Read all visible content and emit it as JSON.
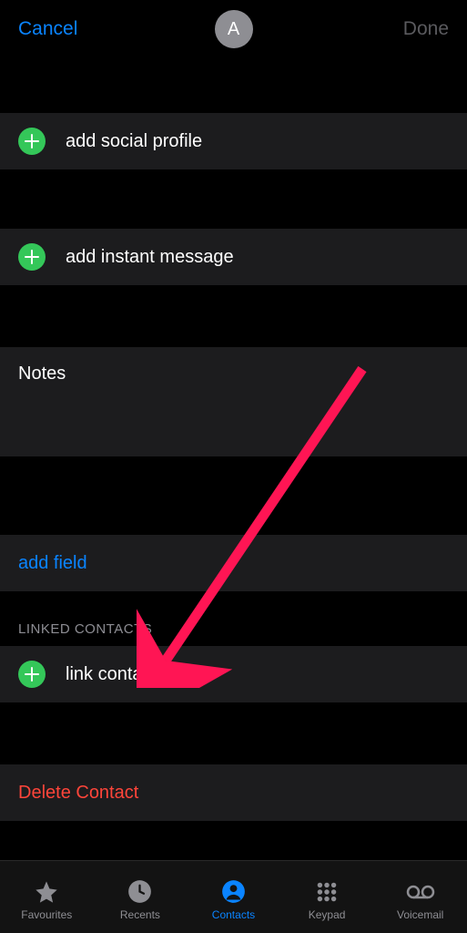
{
  "header": {
    "cancel": "Cancel",
    "avatar_initial": "A",
    "done": "Done"
  },
  "rows": {
    "add_social_profile": "add social profile",
    "add_instant_message": "add instant message",
    "notes_label": "Notes",
    "add_field": "add field",
    "linked_contacts_header": "LINKED CONTACTS",
    "link_contacts": "link contacts...",
    "delete_contact": "Delete Contact"
  },
  "tabs": {
    "favourites": "Favourites",
    "recents": "Recents",
    "contacts": "Contacts",
    "keypad": "Keypad",
    "voicemail": "Voicemail"
  }
}
